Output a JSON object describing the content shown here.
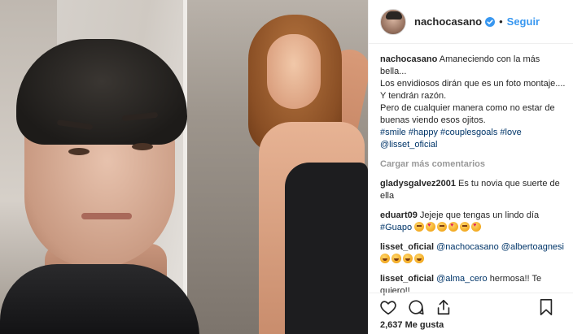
{
  "post": {
    "image_alt": "Selfie photo",
    "author": {
      "username": "nachocasano",
      "verified": true,
      "follow_label": "Seguir",
      "separator": "•"
    },
    "caption": {
      "username": "nachocasano",
      "line1": "Amaneciendo con la más bella...",
      "line2": "Los envidiosos dirán que es un foto montaje....",
      "line3": "Y tendrán razón.",
      "line4": "Pero de cualquier manera como no estar de",
      "line5": "buenas viendo esos ojitos.",
      "hashtags": [
        "#smile",
        "#happy",
        "#couplesgoals",
        "#love"
      ],
      "mention": "@lisset_oficial"
    },
    "load_more_label": "Cargar más comentarios",
    "comments": [
      {
        "username": "gladysgalvez2001",
        "text": "Es tu novia que suerte de",
        "text2": "ella"
      },
      {
        "username": "eduart09",
        "text": "Jejeje que tengas un lindo día",
        "tag": "#Guapo",
        "emojis": [
          "face-blowing-kiss",
          "heart-eyes",
          "face-blowing-kiss",
          "heart-eyes",
          "face-blowing-kiss",
          "heart-eyes"
        ]
      },
      {
        "username": "lisset_oficial",
        "mention1": "@nachocasano",
        "mention2": "@albertoagnesi",
        "emojis": [
          "laughing",
          "laughing",
          "laughing",
          "laughing"
        ]
      },
      {
        "username": "lisset_oficial",
        "mention": "@alma_cero",
        "text": "hermosa!! Te",
        "text2": "quiero!!"
      }
    ],
    "actions": {
      "like_icon": "heart-outline-icon",
      "comment_icon": "comment-bubble-icon",
      "share_icon": "share-icon",
      "save_icon": "bookmark-icon"
    },
    "likes_label": "2,637 Me gusta"
  },
  "colors": {
    "link": "#3897f0",
    "tag": "#003569",
    "muted": "#999999",
    "text": "#262626"
  }
}
